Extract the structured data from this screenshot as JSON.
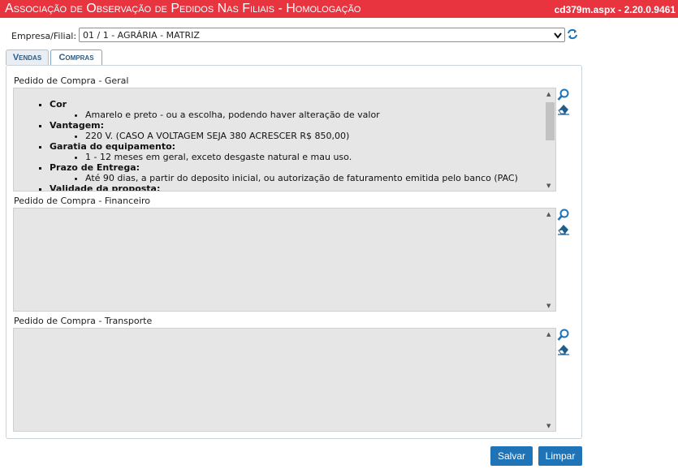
{
  "header": {
    "title": "Associação de Observação de Pedidos Nas Filiais  - Homologação",
    "version": "cd379m.aspx - 2.20.0.9461"
  },
  "empresa": {
    "label": "Empresa/Filial:",
    "selected": "01 / 1 - AGRÁRIA - MATRIZ"
  },
  "tabs": [
    {
      "label": "Vendas",
      "active": false
    },
    {
      "label": "Compras",
      "active": true
    }
  ],
  "sections": {
    "geral": {
      "label": "Pedido de Compra - Geral",
      "items": [
        {
          "title": "Cor",
          "detail": "Amarelo e preto - ou a escolha, podendo haver alteração de valor"
        },
        {
          "title": "Vantagem:",
          "detail": "220 V. (CASO A VOLTAGEM SEJA 380 ACRESCER R$ 850,00)"
        },
        {
          "title": "Garatia do equipamento:",
          "detail": "1 - 12 meses em geral, exceto desgaste natural e mau uso."
        },
        {
          "title": "Prazo de Entrega:",
          "detail": "Até 90 dias, a partir do deposito inicial, ou autorização de faturamento emitida pelo banco (PAC)"
        },
        {
          "title": "Validade da proposta:",
          "detail": ""
        }
      ]
    },
    "financeiro": {
      "label": "Pedido de Compra - Financeiro"
    },
    "transporte": {
      "label": "Pedido de Compra - Transporte"
    }
  },
  "buttons": {
    "salvar": "Salvar",
    "limpar": "Limpar"
  },
  "icons": {
    "search": "search-icon",
    "clear": "eraser-icon",
    "refresh": "refresh-icon"
  },
  "colors": {
    "title_bar": "#e8343e",
    "button": "#1f73b7",
    "textarea_bg": "#e6e6e6"
  }
}
